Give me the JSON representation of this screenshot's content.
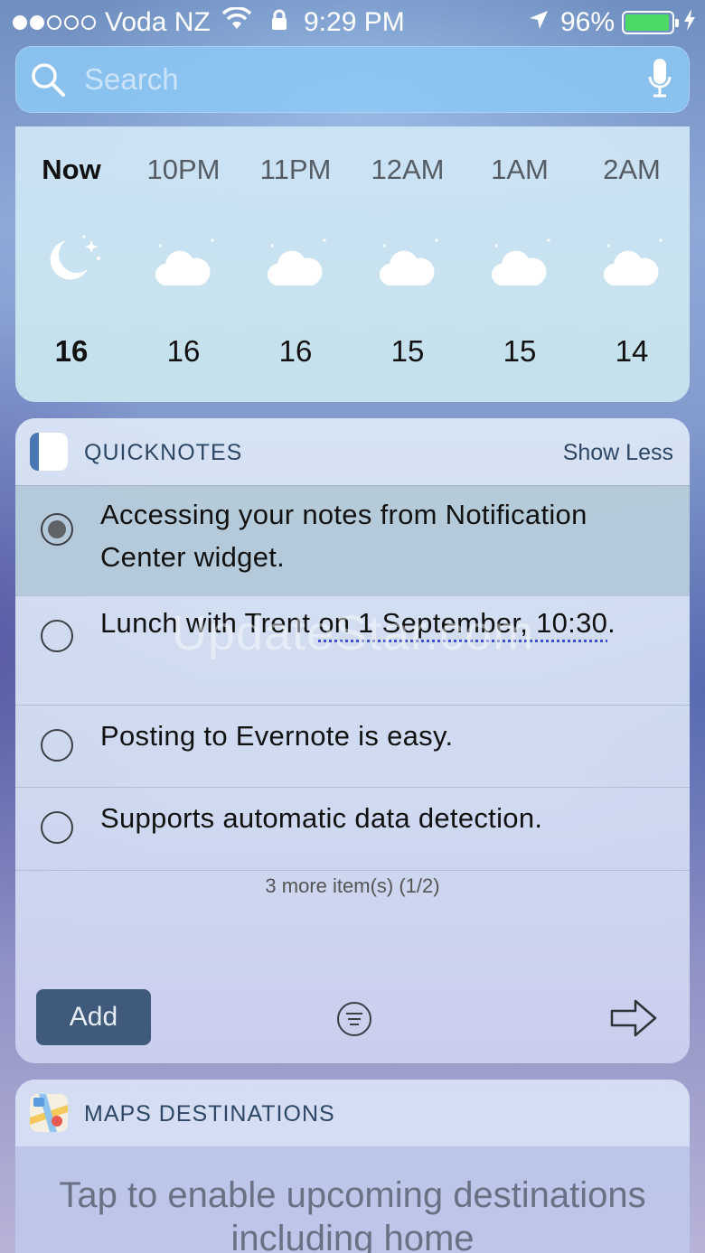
{
  "status_bar": {
    "signal_bars_filled": 2,
    "signal_bars_total": 5,
    "carrier": "Voda NZ",
    "time": "9:29 PM",
    "battery_percent": "96%",
    "battery_level": 0.96,
    "colors": {
      "battery_fill": "#4cd964"
    }
  },
  "search": {
    "placeholder": "Search",
    "icons": {
      "left": "search-icon",
      "right": "microphone-icon"
    }
  },
  "weather": {
    "hours": [
      {
        "label": "Now",
        "icon": "moon-stars-icon",
        "temp": "16"
      },
      {
        "label": "10PM",
        "icon": "cloud-moon-icon",
        "temp": "16"
      },
      {
        "label": "11PM",
        "icon": "cloud-moon-icon",
        "temp": "16"
      },
      {
        "label": "12AM",
        "icon": "cloud-moon-icon",
        "temp": "15"
      },
      {
        "label": "1AM",
        "icon": "cloud-moon-icon",
        "temp": "15"
      },
      {
        "label": "2AM",
        "icon": "cloud-moon-icon",
        "temp": "14"
      }
    ]
  },
  "quicknotes": {
    "title": "QUICKNOTES",
    "toggle_label": "Show Less",
    "items": [
      {
        "text": "Accessing your notes from Notification Center widget.",
        "selected": true
      },
      {
        "text_plain": "Lunch with Trent ",
        "text_link": "on 1 September, 10:30",
        "text_end": ".",
        "selected": false
      },
      {
        "text": "Posting to Evernote is easy.",
        "selected": false
      },
      {
        "text": "Supports automatic data detection.",
        "selected": false
      }
    ],
    "more_label": "3 more item(s) (1/2)",
    "add_label": "Add",
    "colors": {
      "add_button": "#3f5a7a",
      "brand": "#4b76b4"
    }
  },
  "maps": {
    "title": "MAPS DESTINATIONS",
    "body_text": "Tap to enable upcoming destinations including home"
  },
  "watermark": "UpdateStar.com"
}
